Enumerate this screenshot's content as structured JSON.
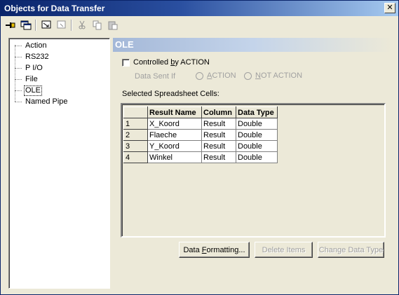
{
  "window": {
    "title": "Objects for Data Transfer"
  },
  "toolbar": {
    "buttons": [
      "pin-icon",
      "window-icon",
      "transfer-icon",
      "link-icon",
      "cut-icon",
      "copy-icon",
      "paste-icon"
    ]
  },
  "tree": {
    "items": [
      {
        "label": "Action"
      },
      {
        "label": "RS232"
      },
      {
        "label": "P I/O"
      },
      {
        "label": "File"
      },
      {
        "label": "OLE"
      },
      {
        "label": "Named Pipe"
      }
    ],
    "selected": "OLE"
  },
  "panel": {
    "header": "OLE",
    "controlled_checkbox": {
      "label_pre": "Controlled ",
      "label_u": "b",
      "label_post": "y ACTION",
      "checked": false
    },
    "data_sent_if": "Data Sent If",
    "radio_action": {
      "u": "A",
      "rest": "CTION"
    },
    "radio_not_action": {
      "u": "N",
      "rest": "OT ACTION"
    },
    "selected_cells_label": "Selected Spreadsheet Cells:",
    "table": {
      "columns": [
        "Result Name",
        "Column",
        "Data Type"
      ],
      "rows": [
        {
          "num": "1",
          "name": "X_Koord",
          "column": "Result",
          "type": "Double"
        },
        {
          "num": "2",
          "name": "Flaeche",
          "column": "Result",
          "type": "Double"
        },
        {
          "num": "3",
          "name": "Y_Koord",
          "column": "Result",
          "type": "Double"
        },
        {
          "num": "4",
          "name": "Winkel",
          "column": "Result",
          "type": "Double"
        }
      ]
    },
    "buttons": {
      "formatting": {
        "pre": "Data ",
        "u": "F",
        "post": "ormatting..."
      },
      "delete": "Delete Items",
      "change_type": "Change Data Type"
    }
  },
  "colors": {
    "title_bar": "#0a246a",
    "panel_header": "#a4b8d8",
    "face": "#ece9d8"
  }
}
